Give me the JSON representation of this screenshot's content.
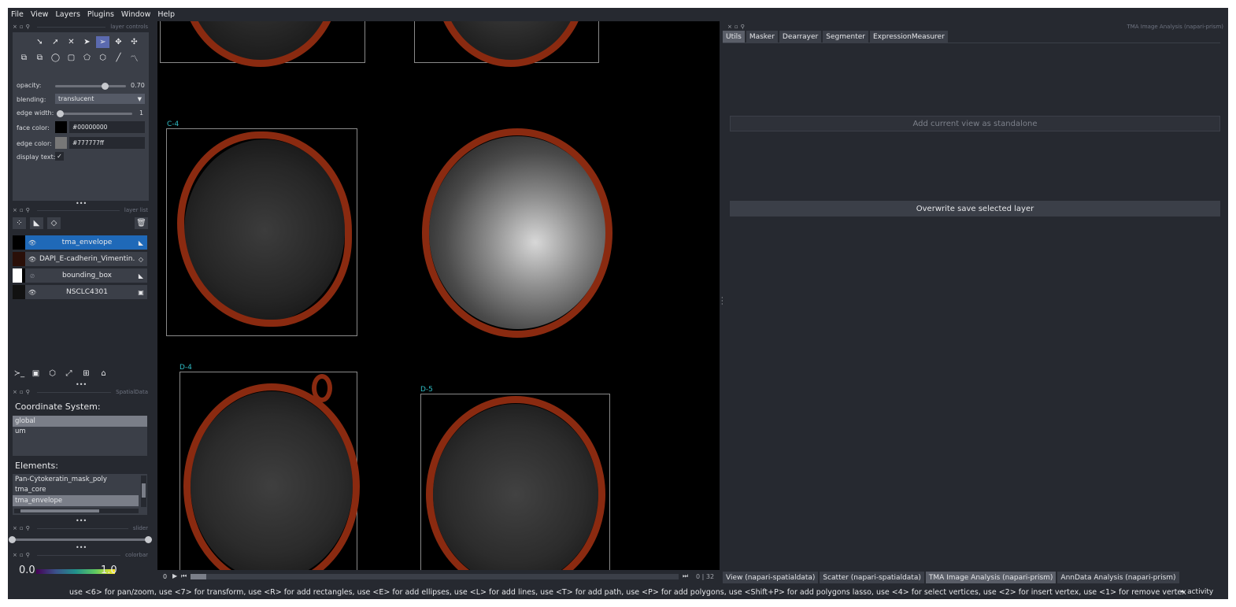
{
  "menu": [
    "File",
    "View",
    "Layers",
    "Plugins",
    "Window",
    "Help"
  ],
  "docks": {
    "layer_controls": "layer controls",
    "layer_list": "layer list",
    "spatialdata": "SpatialData",
    "slider": "slider",
    "colorbar": "colorbar",
    "tma": "TMA Image Analysis (napari-prism)"
  },
  "layer_controls": {
    "opacity_label": "opacity:",
    "opacity_value": "0.70",
    "opacity_fraction": 0.7,
    "blending_label": "blending:",
    "blending_value": "translucent",
    "edge_width_label": "edge width:",
    "edge_width_value": "1",
    "face_color_label": "face color:",
    "face_color_value": "#00000000",
    "edge_color_label": "edge color:",
    "edge_color_value": "#777777ff",
    "display_text_label": "display text:",
    "display_text_checked": true
  },
  "layers": [
    {
      "name": "tma_envelope",
      "selected": true,
      "visible": true,
      "type_icon": "shapes-icon"
    },
    {
      "name": "DAPI_E-cadherin_Vimentin...",
      "selected": false,
      "visible": true,
      "type_icon": "labels-icon"
    },
    {
      "name": "bounding_box",
      "selected": false,
      "visible": false,
      "type_icon": "shapes-icon"
    },
    {
      "name": "NSCLC4301",
      "selected": false,
      "visible": true,
      "type_icon": "image-icon"
    }
  ],
  "spatialdata": {
    "coord_title": "Coordinate System:",
    "coord_items": [
      "global",
      "um"
    ],
    "coord_selected": "global",
    "elements_title": "Elements:",
    "element_items": [
      "Pan-Cytokeratin_mask_poly",
      "tma_core",
      "tma_envelope"
    ],
    "element_selected": "tma_envelope"
  },
  "colorbar": {
    "min": "0.0",
    "max": "1.0"
  },
  "canvas": {
    "core_labels": [
      "C-4",
      "D-4",
      "D-5"
    ]
  },
  "dims": {
    "current": "0",
    "counter": "0 | 32"
  },
  "tma": {
    "tabs": [
      "Utils",
      "Masker",
      "Dearrayer",
      "Segmenter",
      "ExpressionMeasurer"
    ],
    "active_tab": "Utils",
    "add_view_button": "Add current view as standalone",
    "overwrite_button": "Overwrite save selected layer"
  },
  "bottom_tabs": [
    "View (napari-spatialdata)",
    "Scatter (napari-spatialdata)",
    "TMA Image Analysis (napari-prism)",
    "AnnData Analysis (napari-prism)"
  ],
  "bottom_active": "TMA Image Analysis (napari-prism)",
  "status": {
    "hint": "use <6> for pan/zoom, use <7> for transform, use <R> for add rectangles, use <E> for add ellipses, use <L> for add lines, use <T> for add path, use <P> for add polygons, use <Shift+P> for add polygons lasso, use <4> for select vertices, use <2> for insert vertex, use <1> for remove vertex",
    "activity": "activity"
  },
  "colors": {
    "background": "#262930",
    "panel": "#3b3f48",
    "selection": "#1f69b8",
    "envelope": "#8a2a10",
    "core_label": "#2fbcc4"
  }
}
